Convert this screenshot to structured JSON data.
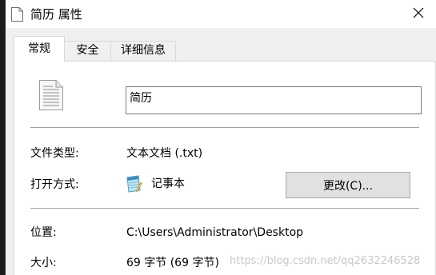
{
  "window": {
    "title": "简历 属性",
    "close_icon": "close-icon",
    "title_icon": "text-file-icon"
  },
  "tabs": [
    {
      "label": "常规",
      "active": true
    },
    {
      "label": "安全",
      "active": false
    },
    {
      "label": "详细信息",
      "active": false
    }
  ],
  "general": {
    "file_icon": "text-document-icon",
    "file_name": "简历",
    "file_type_label": "文件类型:",
    "file_type_value": "文本文档 (.txt)",
    "open_with_label": "打开方式:",
    "open_with_icon": "notepad-icon",
    "open_with_value": "记事本",
    "change_button": "更改(C)...",
    "location_label": "位置:",
    "location_value": "C:\\Users\\Administrator\\Desktop",
    "size_label": "大小:",
    "size_value": "69 字节 (69 字节)"
  },
  "watermark": "https://blog.csdn.net/qq2632246528"
}
